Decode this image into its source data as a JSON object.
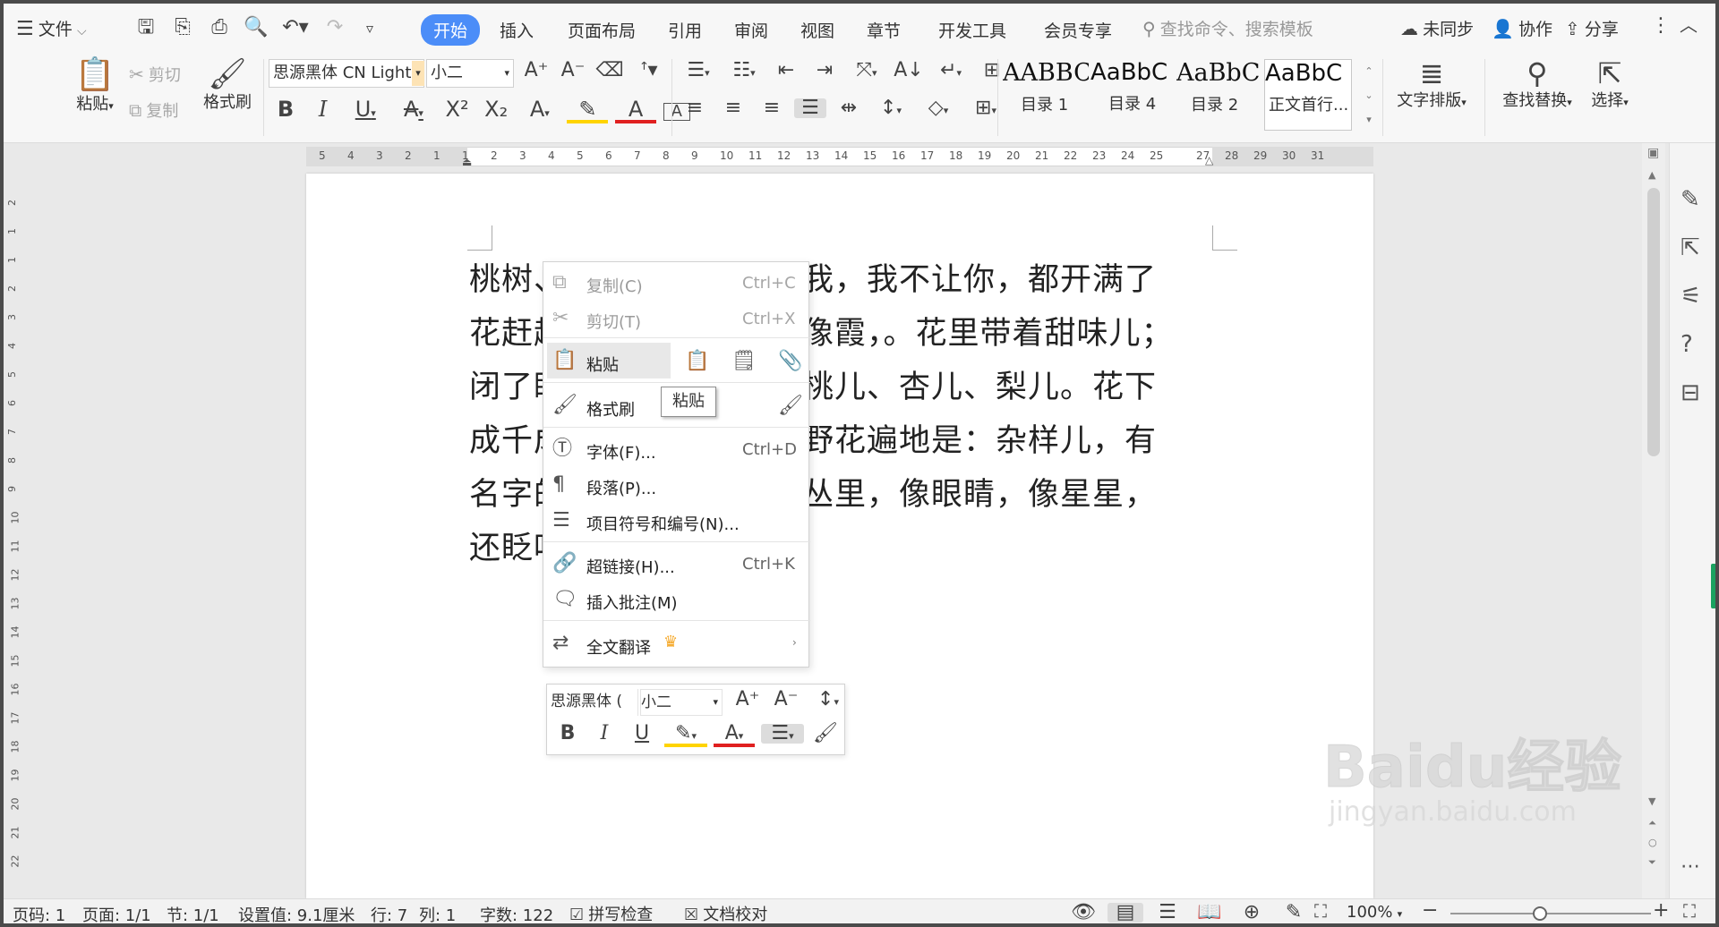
{
  "titlebar": {
    "menu_label": "文件",
    "tabs": [
      "开始",
      "插入",
      "页面布局",
      "引用",
      "审阅",
      "视图",
      "章节",
      "开发工具",
      "会员专享"
    ],
    "search_placeholder": "查找命令、搜索模板",
    "sync_label": "未同步",
    "collab_label": "协作",
    "share_label": "分享"
  },
  "ribbon": {
    "paste": "粘贴",
    "cut": "剪切",
    "copy": "复制",
    "format_painter": "格式刷",
    "font_name": "思源黑体 CN Light",
    "font_size": "小二",
    "styles": [
      {
        "preview": "AABBCC",
        "label": "目录 1"
      },
      {
        "preview": "AaBbC",
        "label": "目录 4"
      },
      {
        "preview": "AaBbC",
        "label": "目录 2"
      },
      {
        "preview": "AaBbC",
        "label": "正文首行..."
      }
    ],
    "text_layout": "文字排版",
    "find_replace": "查找替换",
    "select": "选择"
  },
  "ruler": {
    "numbers": [
      "5",
      "4",
      "3",
      "2",
      "1",
      "1",
      "2",
      "3",
      "4",
      "5",
      "6",
      "7",
      "8",
      "9",
      "10",
      "11",
      "12",
      "13",
      "14",
      "15",
      "16",
      "17",
      "18",
      "19",
      "20",
      "21",
      "22",
      "23",
      "24",
      "25",
      "27",
      "28",
      "29",
      "30",
      "31"
    ],
    "left_numbers": [
      "2",
      "1",
      "1",
      "2",
      "3",
      "4",
      "5",
      "6",
      "7",
      "8",
      "9",
      "10",
      "11",
      "12",
      "13",
      "14",
      "15",
      "16",
      "17",
      "18",
      "19",
      "20",
      "21",
      "22"
    ]
  },
  "document": {
    "lines": [
      {
        "left": "桃树、",
        "right": "不让我，我不让你，都开满了"
      },
      {
        "left": "花赶趟",
        "right": "粉的像霞，。花里带着甜味儿；"
      },
      {
        "left": "闭了眼",
        "right": "满是桃儿、杏儿、梨儿。花下"
      },
      {
        "left": "成千成",
        "right": "蝶。野花遍地是：杂样儿，有"
      },
      {
        "left": "名字的",
        "right": "在草丛里，像眼睛，像星星，"
      },
      {
        "left": "还眨呀",
        "right": ""
      }
    ]
  },
  "context_menu": {
    "copy": {
      "label": "复制(C)",
      "shortcut": "Ctrl+C"
    },
    "cut": {
      "label": "剪切(T)",
      "shortcut": "Ctrl+X"
    },
    "paste": {
      "label": "粘贴"
    },
    "paste_tooltip": "粘贴",
    "format_painter": {
      "label": "格式刷"
    },
    "font": {
      "label": "字体(F)...",
      "shortcut": "Ctrl+D"
    },
    "paragraph": {
      "label": "段落(P)..."
    },
    "bullets": {
      "label": "项目符号和编号(N)..."
    },
    "hyperlink": {
      "label": "超链接(H)...",
      "shortcut": "Ctrl+K"
    },
    "comment": {
      "label": "插入批注(M)"
    },
    "translate": {
      "label": "全文翻译"
    }
  },
  "mini_toolbar": {
    "font_name": "思源黑体 (",
    "font_size": "小二"
  },
  "statusbar": {
    "page_code": "页码: 1",
    "page": "页面: 1/1",
    "section": "节: 1/1",
    "setting": "设置值: 9.1厘米",
    "row": "行: 7",
    "col": "列: 1",
    "word_count": "字数: 122",
    "spell_check": "拼写检查",
    "doc_proof": "文档校对",
    "zoom": "100%"
  },
  "watermark": {
    "brand": "Baidu经验",
    "url": "jingyan.baidu.com"
  },
  "colors": {
    "accent": "#4b8df8",
    "highlight": "#ffd400",
    "font_color": "#e02020",
    "crown": "#f5a623"
  }
}
